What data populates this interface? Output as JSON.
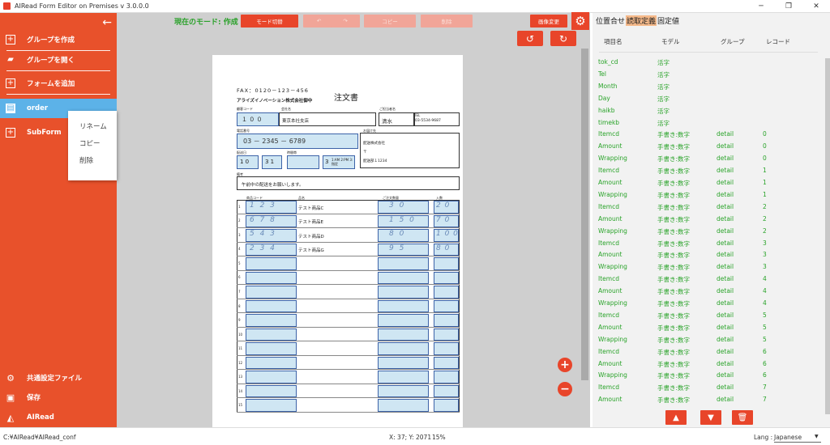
{
  "window": {
    "title": "AIRead Form Editor on Premises v 3.0.0.0"
  },
  "sidebar": {
    "items": [
      {
        "label": "グループを作成"
      },
      {
        "label": "グループを開く"
      },
      {
        "label": "フォームを追加"
      },
      {
        "label": "order"
      },
      {
        "label": "SubForm"
      },
      {
        "label": "共通設定ファイル"
      },
      {
        "label": "保存"
      },
      {
        "label": "AIRead"
      }
    ],
    "context_menu": [
      "リネーム",
      "コピー",
      "削除"
    ]
  },
  "toolbar": {
    "mode_label": "現在のモード: 作成",
    "mode_switch": "モード切替",
    "copy": "コピー",
    "delete": "削除",
    "image_change": "画像変更"
  },
  "form": {
    "fax": "FAX：0120－123－456",
    "title": "注文書",
    "company": "アライズイノベーション株式会社御中",
    "labels": {
      "cust_code": "顧客コード",
      "cust_name": "会社名",
      "person": "ご担当者名",
      "tel": "TEL",
      "phone": "電話番号",
      "delivery": "お届け先",
      "date": "配送日",
      "time": "時間帯",
      "note": "備考",
      "code": "商品コード",
      "name": "品名",
      "qty": "ご注文数量",
      "unit": "入数"
    },
    "cust_code": "１ ０ ０",
    "cust_name": "東京本社支店",
    "person": "清水",
    "tel_value": "03-5534-9687",
    "phone": "03 － 2345 － 6789",
    "delivery_name": "配送株式会社",
    "delivery_addr": "〒",
    "delivery_dept": "配送部１1234",
    "month": "1 0",
    "day": "3 1",
    "time_no": "3",
    "time_opts": "1:AM 2:PM 3:指定",
    "note_text": "午前中の配送をお願いします。",
    "rows": [
      {
        "no": "1",
        "code": "1 2 3",
        "name": "テスト商品C",
        "qty": "3 0",
        "unit": "2 0"
      },
      {
        "no": "2",
        "code": "6 7 8",
        "name": "テスト商品E",
        "qty": "1 5 0",
        "unit": "7 0"
      },
      {
        "no": "3",
        "code": "5 4 3",
        "name": "テスト商品D",
        "qty": "8 0",
        "unit": "1 0 0"
      },
      {
        "no": "4",
        "code": "2 3 4",
        "name": "テスト商品G",
        "qty": "9 5",
        "unit": "8 0"
      },
      {
        "no": "5"
      },
      {
        "no": "6"
      },
      {
        "no": "7"
      },
      {
        "no": "8"
      },
      {
        "no": "9"
      },
      {
        "no": "10"
      },
      {
        "no": "11"
      },
      {
        "no": "12"
      },
      {
        "no": "13"
      },
      {
        "no": "14"
      },
      {
        "no": "15"
      }
    ]
  },
  "panel": {
    "tabs": [
      "位置合せ",
      "読取定義",
      "固定値"
    ],
    "headers": [
      "項目名",
      "モデル",
      "グループ",
      "レコード"
    ],
    "rows": [
      {
        "name": "tok_cd",
        "model": "活字",
        "group": "",
        "record": ""
      },
      {
        "name": "Tel",
        "model": "活字",
        "group": "",
        "record": ""
      },
      {
        "name": "Month",
        "model": "活字",
        "group": "",
        "record": ""
      },
      {
        "name": "Day",
        "model": "活字",
        "group": "",
        "record": ""
      },
      {
        "name": "haikb",
        "model": "活字",
        "group": "",
        "record": ""
      },
      {
        "name": "timekb",
        "model": "活字",
        "group": "",
        "record": ""
      },
      {
        "name": "Itemcd",
        "model": "手書き:数字",
        "group": "detail",
        "record": "0"
      },
      {
        "name": "Amount",
        "model": "手書き:数字",
        "group": "detail",
        "record": "0"
      },
      {
        "name": "Wrapping",
        "model": "手書き:数字",
        "group": "detail",
        "record": "0"
      },
      {
        "name": "Itemcd",
        "model": "手書き:数字",
        "group": "detail",
        "record": "1"
      },
      {
        "name": "Amount",
        "model": "手書き:数字",
        "group": "detail",
        "record": "1"
      },
      {
        "name": "Wrapping",
        "model": "手書き:数字",
        "group": "detail",
        "record": "1"
      },
      {
        "name": "Itemcd",
        "model": "手書き:数字",
        "group": "detail",
        "record": "2"
      },
      {
        "name": "Amount",
        "model": "手書き:数字",
        "group": "detail",
        "record": "2"
      },
      {
        "name": "Wrapping",
        "model": "手書き:数字",
        "group": "detail",
        "record": "2"
      },
      {
        "name": "Itemcd",
        "model": "手書き:数字",
        "group": "detail",
        "record": "3"
      },
      {
        "name": "Amount",
        "model": "手書き:数字",
        "group": "detail",
        "record": "3"
      },
      {
        "name": "Wrapping",
        "model": "手書き:数字",
        "group": "detail",
        "record": "3"
      },
      {
        "name": "Itemcd",
        "model": "手書き:数字",
        "group": "detail",
        "record": "4"
      },
      {
        "name": "Amount",
        "model": "手書き:数字",
        "group": "detail",
        "record": "4"
      },
      {
        "name": "Wrapping",
        "model": "手書き:数字",
        "group": "detail",
        "record": "4"
      },
      {
        "name": "Itemcd",
        "model": "手書き:数字",
        "group": "detail",
        "record": "5"
      },
      {
        "name": "Amount",
        "model": "手書き:数字",
        "group": "detail",
        "record": "5"
      },
      {
        "name": "Wrapping",
        "model": "手書き:数字",
        "group": "detail",
        "record": "5"
      },
      {
        "name": "Itemcd",
        "model": "手書き:数字",
        "group": "detail",
        "record": "6"
      },
      {
        "name": "Amount",
        "model": "手書き:数字",
        "group": "detail",
        "record": "6"
      },
      {
        "name": "Wrapping",
        "model": "手書き:数字",
        "group": "detail",
        "record": "6"
      },
      {
        "name": "Itemcd",
        "model": "手書き:数字",
        "group": "detail",
        "record": "7"
      },
      {
        "name": "Amount",
        "model": "手書き:数字",
        "group": "detail",
        "record": "7"
      }
    ]
  },
  "status": {
    "path": "C:¥AIRead¥AIRead_conf",
    "coords": "X: 37; Y: 2071",
    "zoom": "15%",
    "lang_label": "Lang :",
    "lang_value": "Japanese"
  },
  "colors": {
    "accent": "#e8512b",
    "active": "#5cb2e8",
    "green": "#29a329"
  }
}
